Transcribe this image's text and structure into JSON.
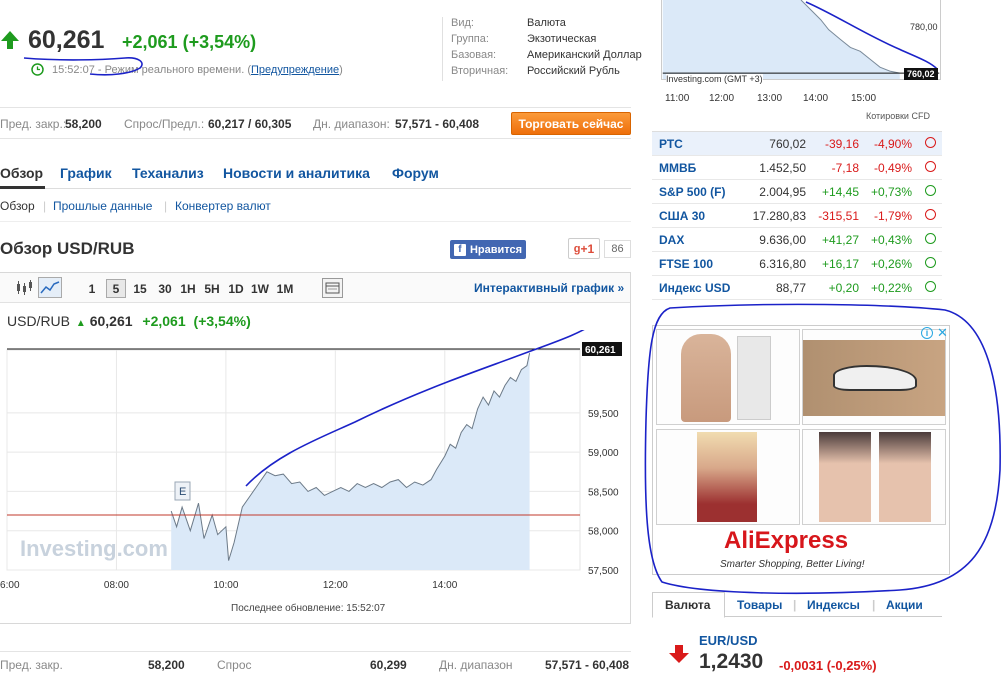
{
  "header": {
    "price": "60,261",
    "change": "+2,061",
    "change_pct": "(+3,54%)",
    "time": "15:52:07",
    "time_label": "- Режим реального времени.",
    "warning_link": "Предупреждение",
    "info": [
      {
        "key": "Вид:",
        "value": "Валюта"
      },
      {
        "key": "Группа:",
        "value": "Экзотическая"
      },
      {
        "key": "Базовая:",
        "value": "Американский Доллар"
      },
      {
        "key": "Вторичная:",
        "value": "Российский Рубль"
      }
    ]
  },
  "quote_strip": {
    "prev_close_label": "Пред. закр.:",
    "prev_close": "58,200",
    "bid_ask_label": "Спрос/Предл.:",
    "bid_ask": "60,217 / 60,305",
    "range_label": "Дн. диапазон:",
    "range": "57,571 - 60,408",
    "trade_button": "Торговать сейчас"
  },
  "tabs": [
    "Обзор",
    "График",
    "Теханализ",
    "Новости и аналитика",
    "Форум"
  ],
  "sub_tabs": [
    "Обзор",
    "Прошлые данные",
    "Конвертер валют"
  ],
  "overview_title": "Обзор USD/RUB",
  "social": {
    "like": "Нравится",
    "gplus": "+1",
    "gplus_count": "86"
  },
  "toolbar": {
    "periods": [
      "1",
      "5",
      "15",
      "30",
      "1H",
      "5H",
      "1D",
      "1W",
      "1M"
    ],
    "active_period": "5",
    "interactive": "Интерактивный график »"
  },
  "chart_legend": {
    "pair": "USD/RUB",
    "price": "60,261",
    "change": "+2,061",
    "change_pct": "(+3,54%)"
  },
  "chart_data": {
    "type": "area",
    "x_ticks": [
      "06:00",
      "08:00",
      "10:00",
      "12:00",
      "14:00"
    ],
    "y_ticks": [
      "57,500",
      "58,000",
      "58,500",
      "59,000",
      "59,500"
    ],
    "ylim": [
      57.5,
      60.3
    ],
    "last_label": "60,261",
    "prev_close_line": 58.2,
    "event_marker": "E",
    "watermark": "Investing.com",
    "series": [
      {
        "values": [
          [
            9.0,
            58.25
          ],
          [
            9.1,
            58.05
          ],
          [
            9.2,
            58.3
          ],
          [
            9.35,
            58.0
          ],
          [
            9.5,
            58.35
          ],
          [
            9.6,
            57.9
          ],
          [
            9.75,
            58.2
          ],
          [
            9.85,
            57.95
          ],
          [
            10.0,
            58.05
          ],
          [
            10.05,
            57.62
          ],
          [
            10.15,
            57.85
          ],
          [
            10.3,
            58.3
          ],
          [
            10.45,
            58.45
          ],
          [
            10.6,
            58.6
          ],
          [
            10.75,
            58.75
          ],
          [
            10.9,
            58.7
          ],
          [
            11.05,
            58.72
          ],
          [
            11.2,
            58.6
          ],
          [
            11.35,
            58.62
          ],
          [
            11.5,
            58.5
          ],
          [
            11.65,
            58.55
          ],
          [
            11.8,
            58.45
          ],
          [
            11.95,
            58.5
          ],
          [
            12.1,
            58.55
          ],
          [
            12.25,
            58.5
          ],
          [
            12.4,
            58.6
          ],
          [
            12.55,
            58.55
          ],
          [
            12.7,
            58.6
          ],
          [
            12.85,
            58.55
          ],
          [
            13.0,
            58.62
          ],
          [
            13.15,
            58.65
          ],
          [
            13.3,
            58.55
          ],
          [
            13.45,
            58.62
          ],
          [
            13.6,
            58.58
          ],
          [
            13.75,
            58.65
          ],
          [
            13.85,
            58.78
          ],
          [
            14.0,
            58.95
          ],
          [
            14.1,
            59.1
          ],
          [
            14.2,
            59.05
          ],
          [
            14.3,
            59.25
          ],
          [
            14.4,
            59.35
          ],
          [
            14.5,
            59.3
          ],
          [
            14.6,
            59.55
          ],
          [
            14.7,
            59.7
          ],
          [
            14.8,
            59.6
          ],
          [
            14.9,
            59.78
          ],
          [
            15.0,
            59.7
          ],
          [
            15.1,
            59.85
          ],
          [
            15.2,
            59.95
          ],
          [
            15.3,
            59.9
          ],
          [
            15.4,
            60.05
          ],
          [
            15.5,
            60.1
          ],
          [
            15.55,
            60.26
          ]
        ]
      }
    ]
  },
  "last_update": "Последнее обновление: 15:52:07",
  "bottom_row": {
    "prev_close_label": "Пред. закр.",
    "prev_close": "58,200",
    "bid_label": "Спрос",
    "bid": "60,299",
    "range_label": "Дн. диапазон",
    "range": "57,571 - 60,408"
  },
  "mini_chart": {
    "y_label": "780,00",
    "last_label": "760,02",
    "source": "Investing.com (GMT +3)",
    "x_ticks": [
      "11:00",
      "12:00",
      "13:00",
      "14:00",
      "15:00"
    ],
    "cfd": "Котировки CFD"
  },
  "indices": [
    {
      "name": "РТС",
      "price": "760,02",
      "change": "-39,16",
      "pct": "-4,90%",
      "dir": "down"
    },
    {
      "name": "ММВБ",
      "price": "1.452,50",
      "change": "-7,18",
      "pct": "-0,49%",
      "dir": "down"
    },
    {
      "name": "S&P 500 (F)",
      "price": "2.004,95",
      "change": "+14,45",
      "pct": "+0,73%",
      "dir": "up"
    },
    {
      "name": "США 30",
      "price": "17.280,83",
      "change": "-315,51",
      "pct": "-1,79%",
      "dir": "down"
    },
    {
      "name": "DAX",
      "price": "9.636,00",
      "change": "+41,27",
      "pct": "+0,43%",
      "dir": "up"
    },
    {
      "name": "FTSE 100",
      "price": "6.316,80",
      "change": "+16,17",
      "pct": "+0,26%",
      "dir": "up"
    },
    {
      "name": "Индекс USD",
      "price": "88,77",
      "change": "+0,20",
      "pct": "+0,22%",
      "dir": "up"
    }
  ],
  "ad": {
    "brand": "AliExpress",
    "tagline": "Smarter Shopping, Better Living!",
    "info": "i",
    "close": "✕"
  },
  "currency_tabs": [
    "Валюта",
    "Товары",
    "Индексы",
    "Акции"
  ],
  "eurusd": {
    "name": "EUR/USD",
    "price": "1,2430",
    "change": "-0,0031 (-0,25%)"
  },
  "colors": {
    "up": "#1e9b1e",
    "down": "#d91a1a",
    "link": "#1256a0",
    "orange": "#ef7410",
    "annotation": "#1b22c8"
  }
}
